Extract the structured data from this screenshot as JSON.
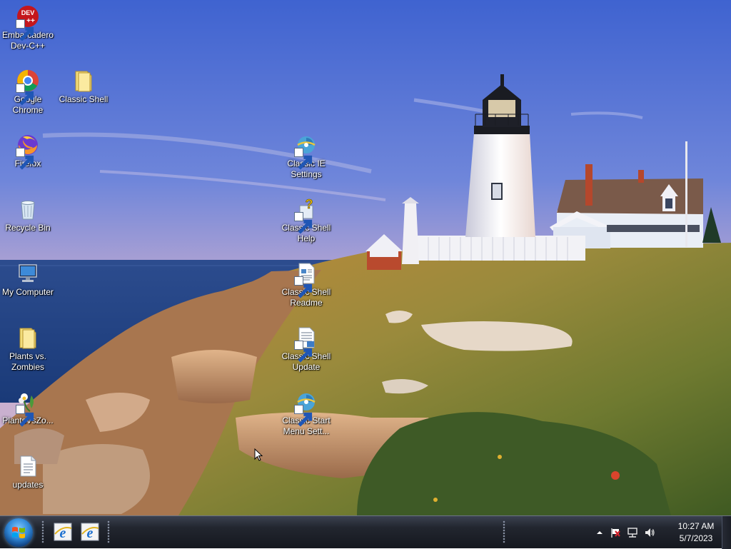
{
  "desktop": {
    "icons": [
      {
        "id": "devcpp",
        "label": "Embarcadero Dev-C++",
        "icon": "dev-cpp-icon",
        "badge": "DEV"
      },
      {
        "id": "chrome",
        "label": "Google Chrome",
        "icon": "chrome-icon"
      },
      {
        "id": "classic-shell-folder",
        "label": "Classic Shell",
        "icon": "folder-icon"
      },
      {
        "id": "firefox",
        "label": "Firefox",
        "icon": "firefox-icon"
      },
      {
        "id": "recycle-bin",
        "label": "Recycle Bin",
        "icon": "recycle-bin-icon"
      },
      {
        "id": "my-computer",
        "label": "My Computer",
        "icon": "computer-icon"
      },
      {
        "id": "plants-folder",
        "label": "Plants vs. Zombies",
        "icon": "folder-icon"
      },
      {
        "id": "plants-exe",
        "label": "PlantsVsZo...",
        "icon": "flower-icon"
      },
      {
        "id": "updates",
        "label": "updates",
        "icon": "text-file-icon"
      },
      {
        "id": "classic-ie-settings",
        "label": "Classic IE Settings",
        "icon": "ie-settings-icon"
      },
      {
        "id": "classic-shell-help",
        "label": "Classic Shell Help",
        "icon": "help-icon"
      },
      {
        "id": "classic-shell-readme",
        "label": "Classic Shell Readme",
        "icon": "document-icon"
      },
      {
        "id": "classic-shell-update",
        "label": "Classic Shell Update",
        "icon": "update-icon"
      },
      {
        "id": "classic-start-menu-settings",
        "label": "Classic Start Menu Sett...",
        "icon": "shell-settings-icon"
      }
    ]
  },
  "taskbar": {
    "start_label": "Start",
    "pinned": [
      {
        "id": "ie-1",
        "icon": "internet-explorer-icon"
      },
      {
        "id": "ie-2",
        "icon": "internet-explorer-icon"
      }
    ],
    "tray": {
      "icons": [
        "show-hidden-icons-icon",
        "action-center-flag-icon",
        "network-icon",
        "volume-icon"
      ],
      "time": "10:27 AM",
      "date": "5/7/2023"
    }
  }
}
